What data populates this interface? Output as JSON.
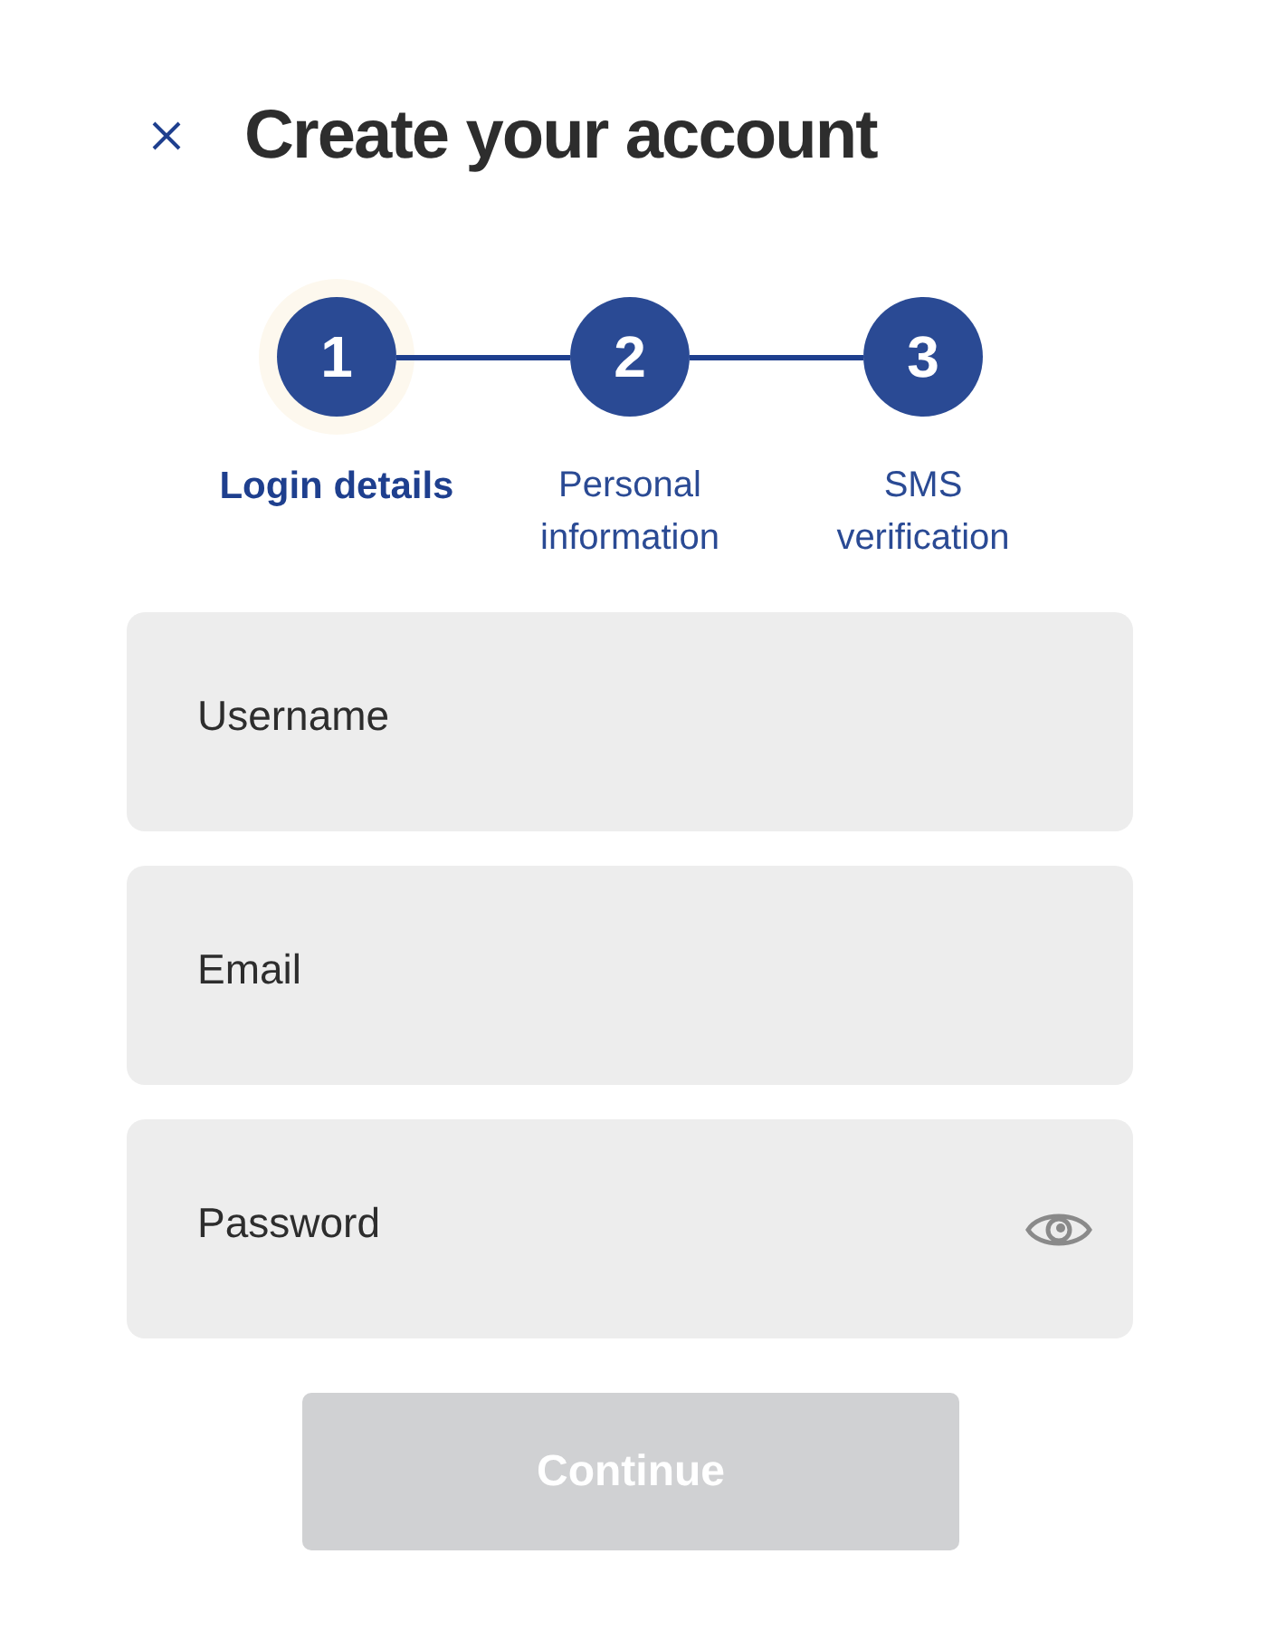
{
  "title": "Create your account",
  "steps": [
    {
      "number": "1",
      "label": "Login details",
      "selected": true
    },
    {
      "number": "2",
      "label": "Personal information",
      "selected": false
    },
    {
      "number": "3",
      "label": "SMS verification",
      "selected": false
    }
  ],
  "fields": [
    {
      "kind": "text",
      "placeholder": "Username"
    },
    {
      "kind": "email",
      "placeholder": "Email"
    },
    {
      "kind": "password",
      "placeholder": "Password"
    }
  ],
  "button": {
    "label": "Continue",
    "disabled": true
  }
}
